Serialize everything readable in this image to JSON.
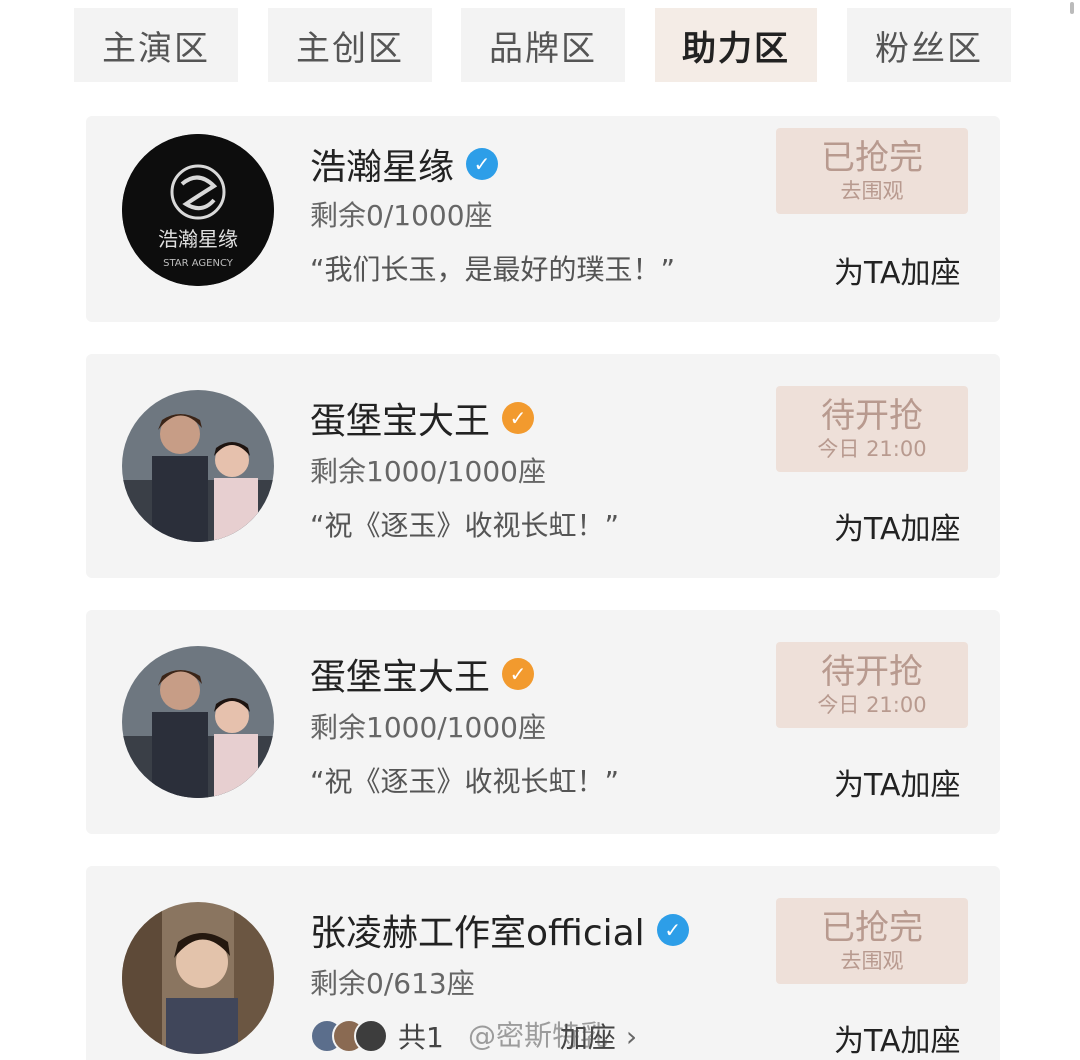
{
  "tabs": [
    {
      "label": "主演区",
      "active": false
    },
    {
      "label": "主创区",
      "active": false
    },
    {
      "label": "品牌区",
      "active": false
    },
    {
      "label": "助力区",
      "active": true
    },
    {
      "label": "粉丝区",
      "active": false
    }
  ],
  "cards": [
    {
      "name": "浩瀚星缘",
      "verified_color": "blue",
      "seats": "剩余0/1000座",
      "quote": "“我们长玉，是最好的璞玉！”",
      "button_main": "已抢完",
      "button_sub": "去围观",
      "add_seat": "为TA加座",
      "logo_text": "浩瀚星缘",
      "logo_sub": "STAR AGENCY"
    },
    {
      "name": "蛋堡宝大王",
      "verified_color": "orange",
      "seats": "剩余1000/1000座",
      "quote": "“祝《逐玉》收视长虹！”",
      "button_main": "待开抢",
      "button_sub": "今日 21:00",
      "add_seat": "为TA加座"
    },
    {
      "name": "蛋堡宝大王",
      "verified_color": "orange",
      "seats": "剩余1000/1000座",
      "quote": "“祝《逐玉》收视长虹！”",
      "button_main": "待开抢",
      "button_sub": "今日 21:00",
      "add_seat": "为TA加座"
    },
    {
      "name": "张凌赫工作室official",
      "verified_color": "blue",
      "seats": "剩余0/613座",
      "fans_text": "共1",
      "fans_suffix": "加座",
      "button_main": "已抢完",
      "button_sub": "去围观",
      "add_seat": "为TA加座"
    }
  ],
  "watermark": "@密斯特乳",
  "icons": {
    "verified": "verified-check-icon",
    "chevron": "chevron-right-icon"
  }
}
